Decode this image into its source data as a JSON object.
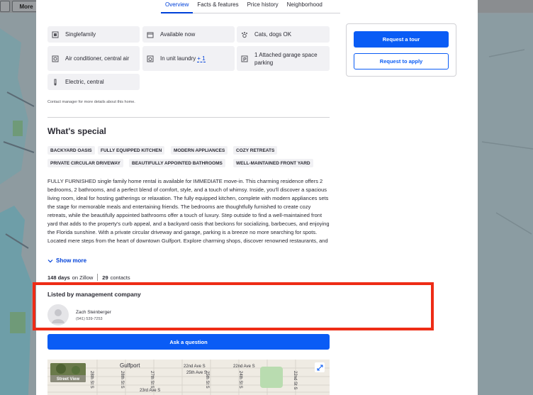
{
  "background": {
    "more_button": "More"
  },
  "tabs": [
    {
      "label": "Overview",
      "active": true
    },
    {
      "label": "Facts & features",
      "active": false
    },
    {
      "label": "Price history",
      "active": false
    },
    {
      "label": "Neighborhood",
      "active": false
    }
  ],
  "facts": [
    {
      "icon": "home-icon",
      "text": "Singlefamily"
    },
    {
      "icon": "calendar-icon",
      "text": "Available now"
    },
    {
      "icon": "paw-icon",
      "text": "Cats, dogs OK"
    },
    {
      "icon": "snowflake-icon",
      "text": "Air conditioner, central air"
    },
    {
      "icon": "laundry-icon",
      "text": "In unit laundry",
      "more": "+ 1"
    },
    {
      "icon": "parking-icon",
      "text": "1 Attached garage space parking"
    },
    {
      "icon": "thermometer-icon",
      "text": "Electric, central"
    }
  ],
  "contact_note": "Contact manager for more details about this home.",
  "whats_special": {
    "heading": "What's special",
    "tags": [
      "BACKYARD OASIS",
      "FULLY EQUIPPED KITCHEN",
      "MODERN APPLIANCES",
      "COZY RETREATS",
      "PRIVATE CIRCULAR DRIVEWAY",
      "BEAUTIFULLY APPOINTED BATHROOMS",
      "WELL-MAINTAINED FRONT YARD"
    ],
    "description": "FULLY FURNISHED single family home rental is available for IMMEDIATE move-in. This charming residence offers 2 bedrooms, 2 bathrooms, and a perfect blend of comfort, style, and a touch of whimsy. Inside, you'll discover a spacious living room, ideal for hosting gatherings or relaxation. The fully equipped kitchen, complete with modern appliances sets the stage for memorable meals and entertaining friends. The bedrooms are thoughtfully furnished to create cozy retreats, while the beautifully appointed bathrooms offer a touch of luxury. Step outside to find a well-maintained front yard that adds to the property's curb appeal, and a backyard oasis that beckons for socializing, barbecues, and enjoying the Florida sunshine. With a private circular driveway and garage, parking is a breeze no more searching for spots. Located mere steps from the heart of downtown Gulfport. Explore charming shops, discover renowned restaurants, and",
    "show_more": "Show more"
  },
  "stats": {
    "days_value": "148 days",
    "days_label": "on Zillow",
    "contacts_value": "29",
    "contacts_label": "contacts"
  },
  "listing": {
    "heading": "Listed by management company",
    "agent_name": "Zach Steinberger",
    "agent_phone": "(941) 539-7253"
  },
  "ask_button": "Ask a question",
  "map": {
    "street_view": "Street View",
    "labels": [
      "Gulfport",
      "22nd Ave S",
      "22nd Ave S",
      "23rd Ave S",
      "28th St S",
      "28th St S",
      "27th St S",
      "25th Ave S",
      "25th St S",
      "24th St S",
      "22nd St S"
    ]
  },
  "actions": {
    "request_tour": "Request a tour",
    "request_apply": "Request to apply"
  },
  "colors": {
    "accent": "#0a5cf5",
    "annotation": "#ee2c16"
  }
}
